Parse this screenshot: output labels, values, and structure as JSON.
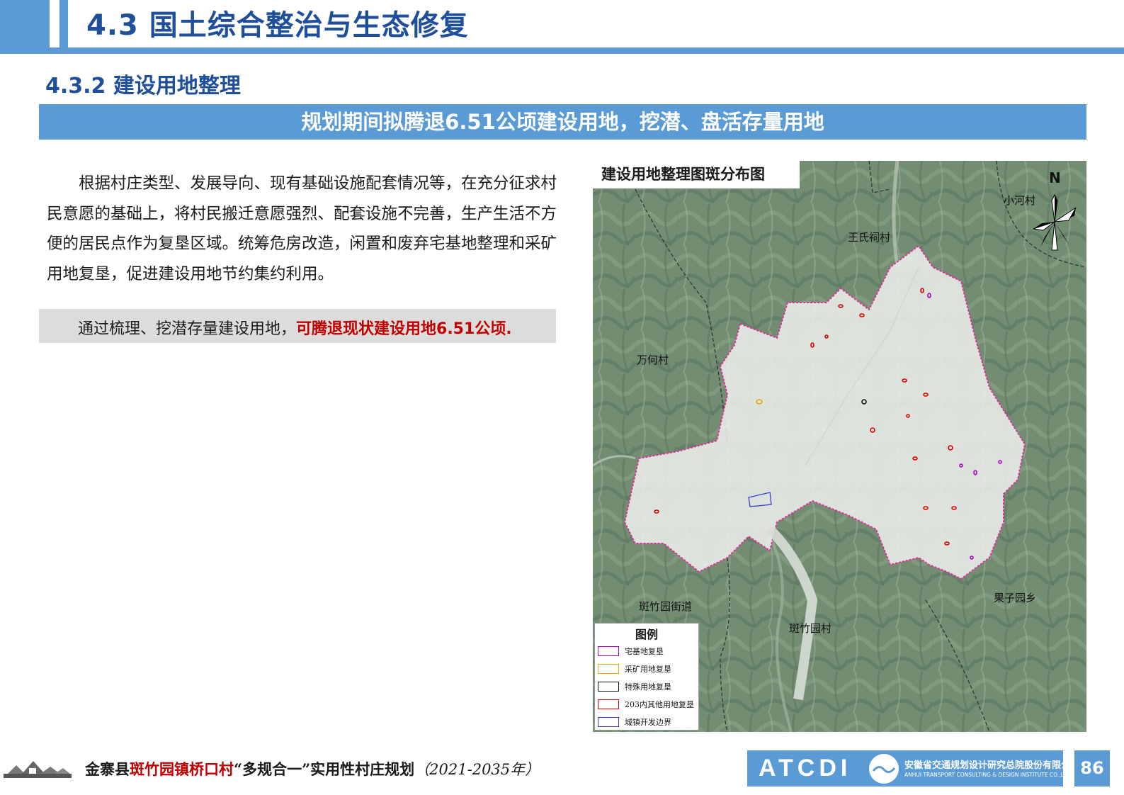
{
  "header": {
    "section_title": "4.3 国土综合整治与生态修复",
    "subsection_title": "4.3.2 建设用地整理",
    "banner": "规划期间拟腾退6.51公顷建设用地，挖潜、盘活存量用地"
  },
  "body": {
    "paragraph": "根据村庄类型、发展导向、现有基础设施配套情况等，在充分征求村民意愿的基础上，将村民搬迁意愿强烈、配套设施不完善，生产生活不方便的居民点作为复垦区域。统筹危房改造，闲置和废弃宅基地整理和采矿用地复垦，促进建设用地节约集约利用。",
    "highlight_prefix": "通过梳理、挖潜存量建设用地，",
    "highlight_emphasis": "可腾退现状建设用地6.51公顷."
  },
  "map": {
    "title": "建设用地整理图斑分布图",
    "north_label": "N",
    "places": [
      "小河村",
      "王氏祠村",
      "万何村",
      "斑竹园街道",
      "斑竹园村",
      "果子园乡"
    ],
    "legend": {
      "title": "图例",
      "items": [
        {
          "label": "宅基地复垦",
          "color": "#b000c8"
        },
        {
          "label": "采矿用地复垦",
          "color": "#f0a800"
        },
        {
          "label": "特殊用地复垦",
          "color": "#111111"
        },
        {
          "label": "203内其他用地复垦",
          "color": "#e00000"
        },
        {
          "label": "城镇开发边界",
          "color": "#3a3ad0"
        }
      ]
    },
    "colors": {
      "boundary": "#e0309a",
      "terrain": "#6f8a71",
      "plan_area": "#e6e8e6"
    }
  },
  "footer": {
    "county": "金寨县",
    "place": "斑竹园镇桥口村",
    "plan_title": "“多规合一”实用性村庄规划",
    "years": "（2021-2035年）",
    "company_logo": "ATCDI",
    "company_cn": "安徽省交通规划设计研究总院股份有限公司",
    "company_en": "ANHUI TRANSPORT CONSULTING & DESIGN INSTITUTE CO.,LTD.",
    "page_number": "86"
  }
}
